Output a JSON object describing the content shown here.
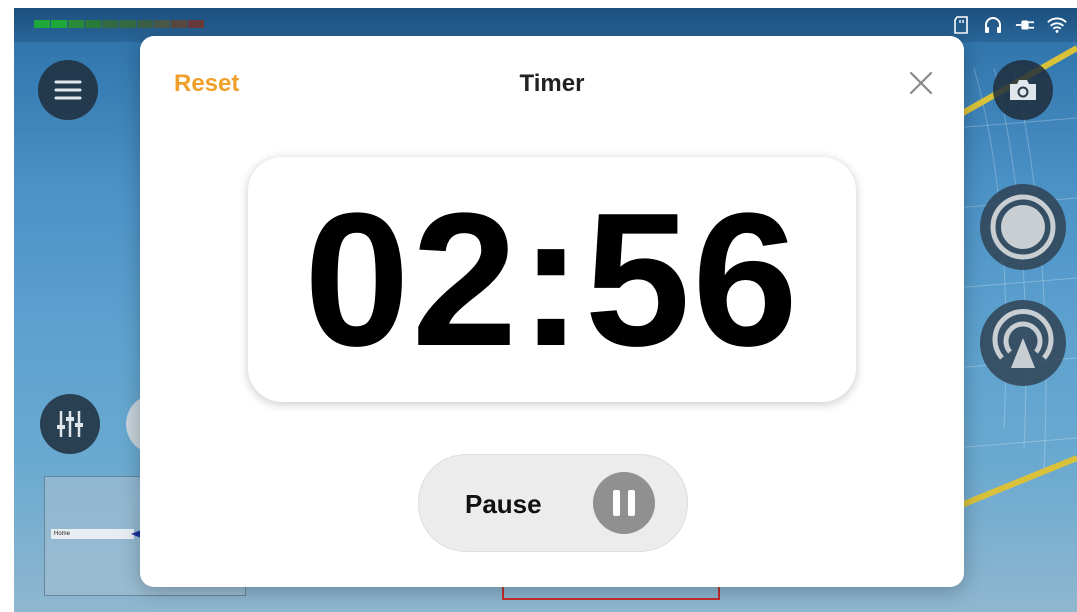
{
  "dialog": {
    "reset_label": "Reset",
    "title": "Timer",
    "time": "02:56",
    "pause_label": "Pause"
  },
  "background": {
    "scoreboard_bar_label": "Home"
  },
  "icons": {
    "menu": "hamburger-menu-icon",
    "camera": "camera-icon",
    "record": "record-icon",
    "stream": "broadcast-icon",
    "mixer": "sliders-icon",
    "close": "close-icon",
    "pause": "pause-icon",
    "sd_card": "sd-card-icon",
    "headphones": "headphones-icon",
    "power": "plug-icon",
    "wifi": "wifi-icon"
  },
  "colors": {
    "accent": "#f0a02a",
    "dialog_bg": "#ffffff",
    "pause_pill_bg": "#ececec",
    "pause_icon_bg": "#909090"
  }
}
